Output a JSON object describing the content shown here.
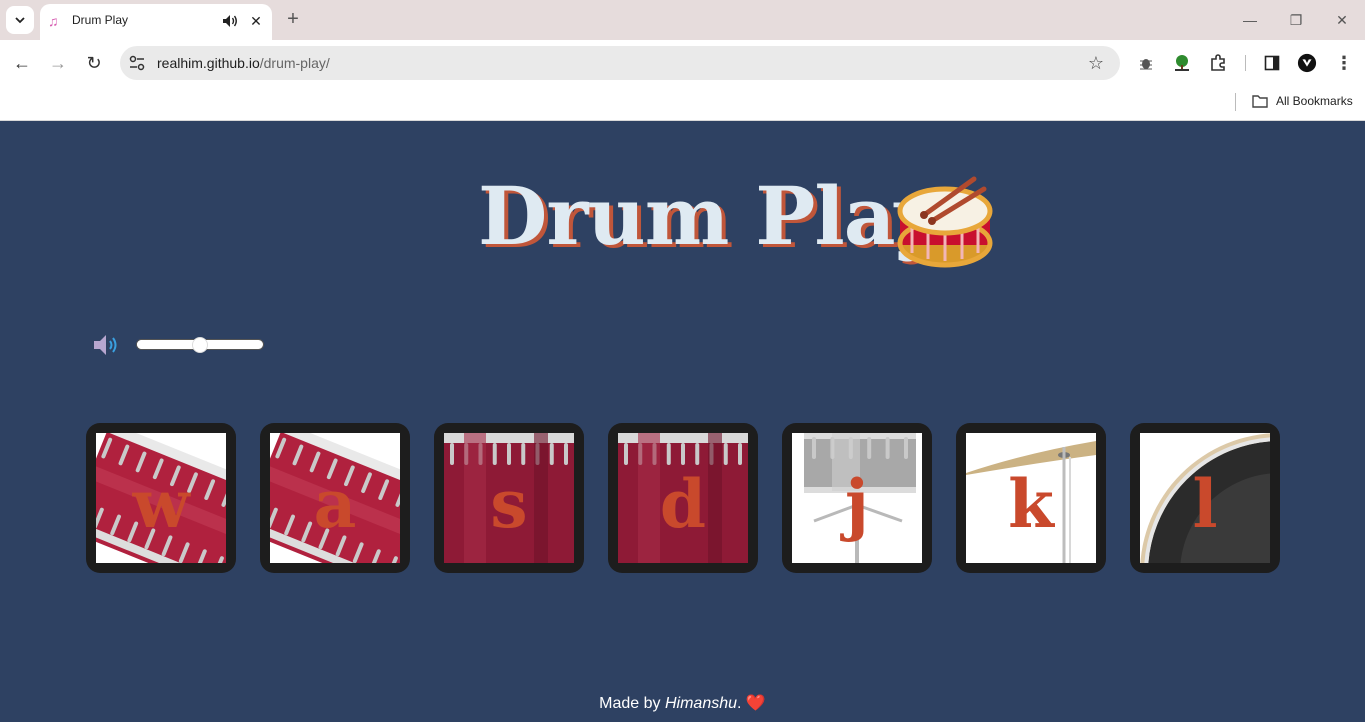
{
  "browser": {
    "tab_title": "Drum Play",
    "url_host": "realhim.github.io",
    "url_path": "/drum-play/",
    "bookmarks_label": "All Bookmarks"
  },
  "page": {
    "title": "Drum Play",
    "title_emoji": "🥁",
    "volume": {
      "value": 0.5
    },
    "footer_prefix": "Made by",
    "footer_author": "Himanshu",
    "footer_suffix": ".",
    "footer_heart": "❤️"
  },
  "pads": [
    {
      "key": "w",
      "drum": "tom-1"
    },
    {
      "key": "a",
      "drum": "tom-2"
    },
    {
      "key": "s",
      "drum": "tom-3"
    },
    {
      "key": "d",
      "drum": "tom-4"
    },
    {
      "key": "j",
      "drum": "snare"
    },
    {
      "key": "k",
      "drum": "cymbal"
    },
    {
      "key": "l",
      "drum": "kick"
    }
  ],
  "colors": {
    "page_bg": "#2e4162",
    "title_text": "#dfeaf2",
    "title_shadow": "#c0563a",
    "key_letter": "#c9492c",
    "pad_frame": "#1d1d1d"
  },
  "icons": [
    "down-chevron-icon",
    "music-note-icon",
    "speaker-icon",
    "close-icon",
    "plus-icon",
    "minimize-icon",
    "restore-icon",
    "back-arrow-icon",
    "forward-arrow-icon",
    "reload-icon",
    "site-info-icon",
    "star-icon",
    "bug-icon",
    "tree-icon",
    "puzzle-icon",
    "side-panel-icon",
    "profile-icon",
    "more-icon",
    "folder-icon",
    "volume-icon"
  ]
}
